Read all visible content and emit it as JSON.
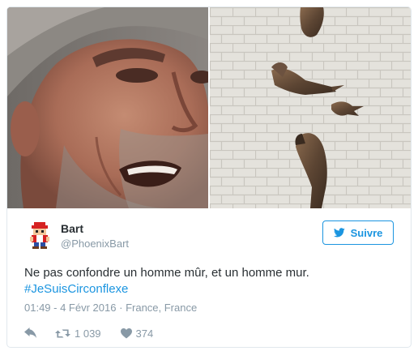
{
  "tweet": {
    "author": {
      "display_name": "Bart",
      "handle": "@PhoenixBart"
    },
    "follow_button": {
      "label": "Suivre",
      "icon": "twitter-bird-icon"
    },
    "text_line_1": "Ne pas confondre un homme mûr, et un homme mur.",
    "hashtag": "#JeSuisCirconflexe",
    "timestamp": "01:49 - 4 Févr 2016",
    "separator": "·",
    "location": "France, France",
    "actions": {
      "reply_icon": "reply-icon",
      "retweet_icon": "retweet-icon",
      "retweet_count": "1 039",
      "like_icon": "heart-icon",
      "like_count": "374"
    },
    "media": [
      {
        "kind": "photo",
        "subject": "close-up of a man's face"
      },
      {
        "kind": "photo",
        "subject": "bronze sculpture of a man emerging from a brick wall"
      }
    ]
  },
  "colors": {
    "accent": "#1b95e0",
    "text": "#292f33",
    "muted": "#8899a6",
    "border": "#e1e8ed"
  }
}
